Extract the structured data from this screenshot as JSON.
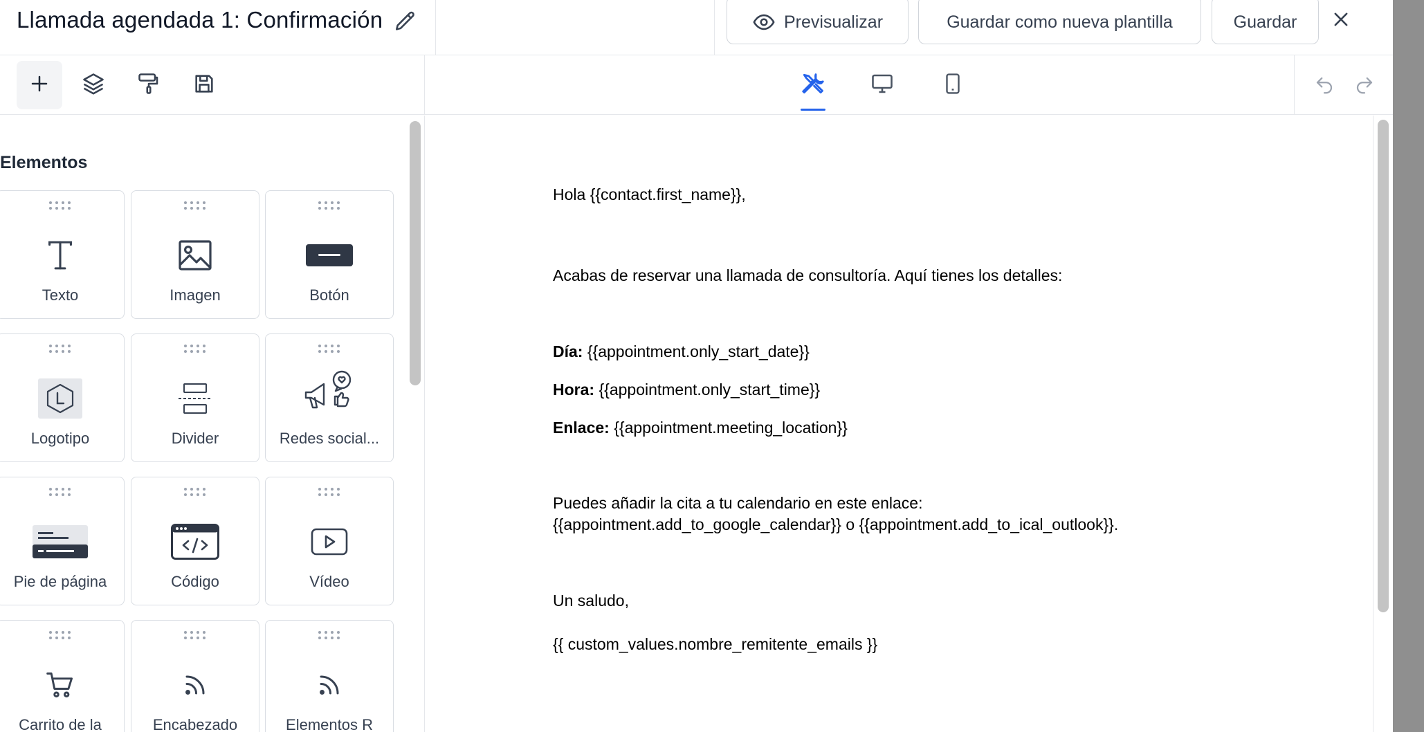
{
  "header": {
    "title": "Llamada agendada 1: Confirmación",
    "preview_label": "Previsualizar",
    "save_template_label": "Guardar como nueva plantilla",
    "save_label": "Guardar"
  },
  "sidebar": {
    "section_title": "Elementos",
    "elements": [
      {
        "label": "Texto",
        "icon": "text-icon"
      },
      {
        "label": "Imagen",
        "icon": "image-icon"
      },
      {
        "label": "Botón",
        "icon": "button-icon"
      },
      {
        "label": "Logotipo",
        "icon": "logo-icon"
      },
      {
        "label": "Divider",
        "icon": "divider-icon"
      },
      {
        "label": "Redes social...",
        "icon": "social-icon"
      },
      {
        "label": "Pie de página",
        "icon": "footer-icon"
      },
      {
        "label": "Código",
        "icon": "code-icon"
      },
      {
        "label": "Vídeo",
        "icon": "video-icon"
      },
      {
        "label": "Carrito de la",
        "icon": "cart-icon"
      },
      {
        "label": "Encabezado",
        "icon": "rss-icon"
      },
      {
        "label": "Elementos R",
        "icon": "rss-icon"
      }
    ]
  },
  "email": {
    "greeting": "Hola {{contact.first_name}},",
    "intro": "Acabas de reservar una llamada de consultoría. Aquí tienes los detalles:",
    "day_label": "Día:",
    "day_value": " {{appointment.only_start_date}}",
    "time_label": "Hora:",
    "time_value": " {{appointment.only_start_time}}",
    "link_label": "Enlace:",
    "link_value": " {{appointment.meeting_location}}",
    "calendar_line1": "Puedes añadir la cita a tu calendario en este enlace:",
    "calendar_line2": "{{appointment.add_to_google_calendar}} o {{appointment.add_to_ical_outlook}}.",
    "closing": "Un saludo,",
    "signature": "{{ custom_values.nombre_remitente_emails }}"
  },
  "colors": {
    "accent": "#2563eb",
    "icon": "#374151",
    "border": "#d9dde3"
  }
}
